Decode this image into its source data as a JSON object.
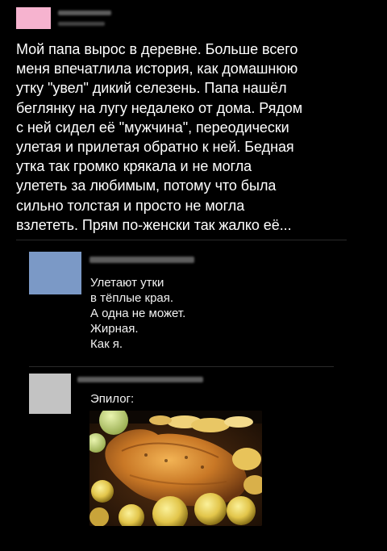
{
  "post": {
    "text_lines": [
      "Мой папа вырос в деревне. Больше всего",
      "меня впечатлила история, как домашнюю",
      "утку \"увел\" дикий селезень. Папа нашёл",
      "беглянку на лугу недалеко от дома. Рядом",
      "с ней сидел её \"мужчина\", переодически",
      "улетая и прилетая обратно к ней. Бедная",
      "утка так громко крякала и не могла",
      "улететь за любимым, потому что была",
      "сильно толстая и просто не могла",
      "взлететь. Прям по-женски так жалко её..."
    ],
    "avatar_color": "#f6b3cf"
  },
  "comments": [
    {
      "avatar_color": "#7b99c6",
      "text_lines": [
        "Улетают утки",
        "в тёплые края.",
        "А одна не может.",
        "Жирная.",
        "Как я."
      ]
    },
    {
      "avatar_color": "#c3c3c3",
      "text_lines": [
        "Эпилог:"
      ],
      "image": "roasted-duck-with-apples-photo"
    }
  ]
}
